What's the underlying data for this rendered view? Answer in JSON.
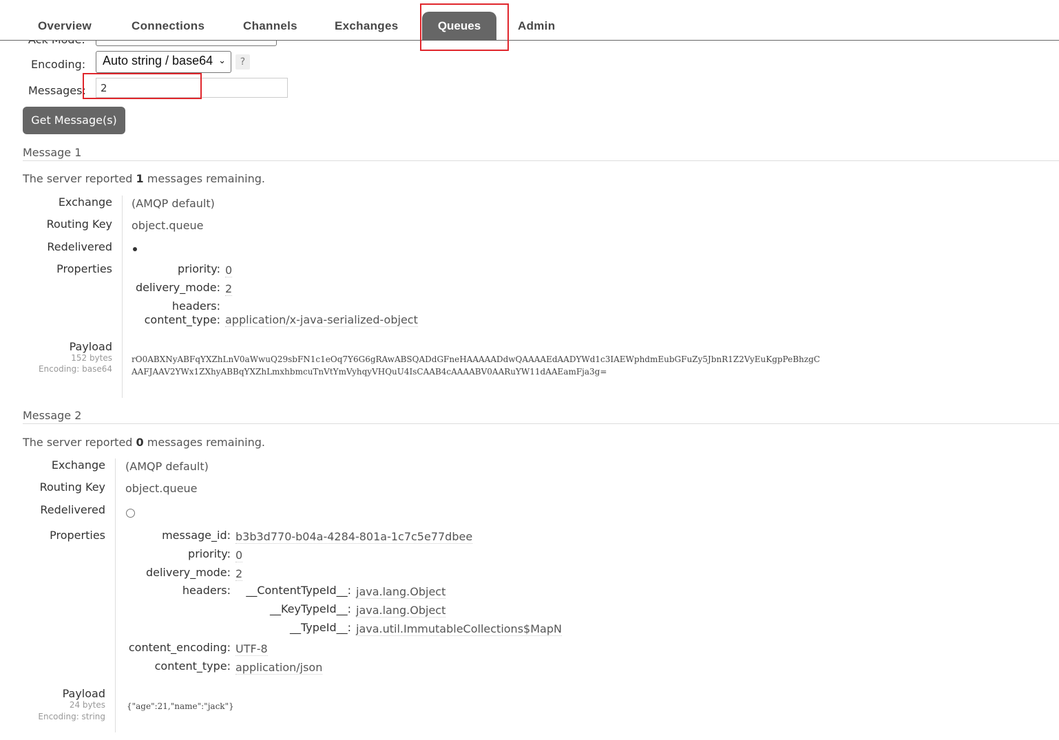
{
  "nav": {
    "tabs": [
      "Overview",
      "Connections",
      "Channels",
      "Exchanges",
      "Queues",
      "Admin"
    ],
    "active": "Queues"
  },
  "form": {
    "ack_mode_label": "Ack Mode:",
    "encoding_label": "Encoding:",
    "encoding_value": "Auto string / base64",
    "help_label": "?",
    "messages_label": "Messages:",
    "messages_value": "2",
    "get_button": "Get Message(s)"
  },
  "labels": {
    "exchange": "Exchange",
    "routing_key": "Routing Key",
    "redelivered": "Redelivered",
    "properties": "Properties",
    "payload": "Payload"
  },
  "messages": [
    {
      "title": "Message 1",
      "server_prefix": "The server reported",
      "remaining": "1",
      "server_suffix": "messages remaining.",
      "exchange": "(AMQP default)",
      "routing_key": "object.queue",
      "redelivered": true,
      "properties": {
        "priority_key": "priority:",
        "priority": "0",
        "delivery_mode_key": "delivery_mode:",
        "delivery_mode": "2",
        "headers_key": "headers:",
        "content_type_key": "content_type:",
        "content_type": "application/x-java-serialized-object"
      },
      "payload_size": "152 bytes",
      "payload_encoding": "Encoding: base64",
      "payload_line1": "rO0ABXNyABFqYXZhLnV0aWwuQ29sbFN1c1eOq7Y6G6gRAwABSQADdGFneHAAAAADdwQAAAAEdAADYWd1c3IAEWphdmEubGFuZy5JbnR1Z2VyEuKgpPeBhzgC",
      "payload_line2": "AAFJAAV2YWx1ZXhyABBqYXZhLmxhbmcuTnVtYmVyhqyVHQuU4IsCAAB4cAAAABV0AARuYW11dAAEamFja3g="
    },
    {
      "title": "Message 2",
      "server_prefix": "The server reported",
      "remaining": "0",
      "server_suffix": "messages remaining.",
      "exchange": "(AMQP default)",
      "routing_key": "object.queue",
      "redelivered": false,
      "properties": {
        "message_id_key": "message_id:",
        "message_id": "b3b3d770-b04a-4284-801a-1c7c5e77dbee",
        "priority_key": "priority:",
        "priority": "0",
        "delivery_mode_key": "delivery_mode:",
        "delivery_mode": "2",
        "headers_key": "headers:",
        "headers": [
          {
            "key": "__ContentTypeId__:",
            "value": "java.lang.Object"
          },
          {
            "key": "__KeyTypeId__:",
            "value": "java.lang.Object"
          },
          {
            "key": "__TypeId__:",
            "value": "java.util.ImmutableCollections$MapN"
          }
        ],
        "content_encoding_key": "content_encoding:",
        "content_encoding": "UTF-8",
        "content_type_key": "content_type:",
        "content_type": "application/json"
      },
      "payload_size": "24 bytes",
      "payload_encoding": "Encoding: string",
      "payload_line1": "{\"age\":21,\"name\":\"jack\"}"
    }
  ],
  "highlight_color": "#e0262c"
}
